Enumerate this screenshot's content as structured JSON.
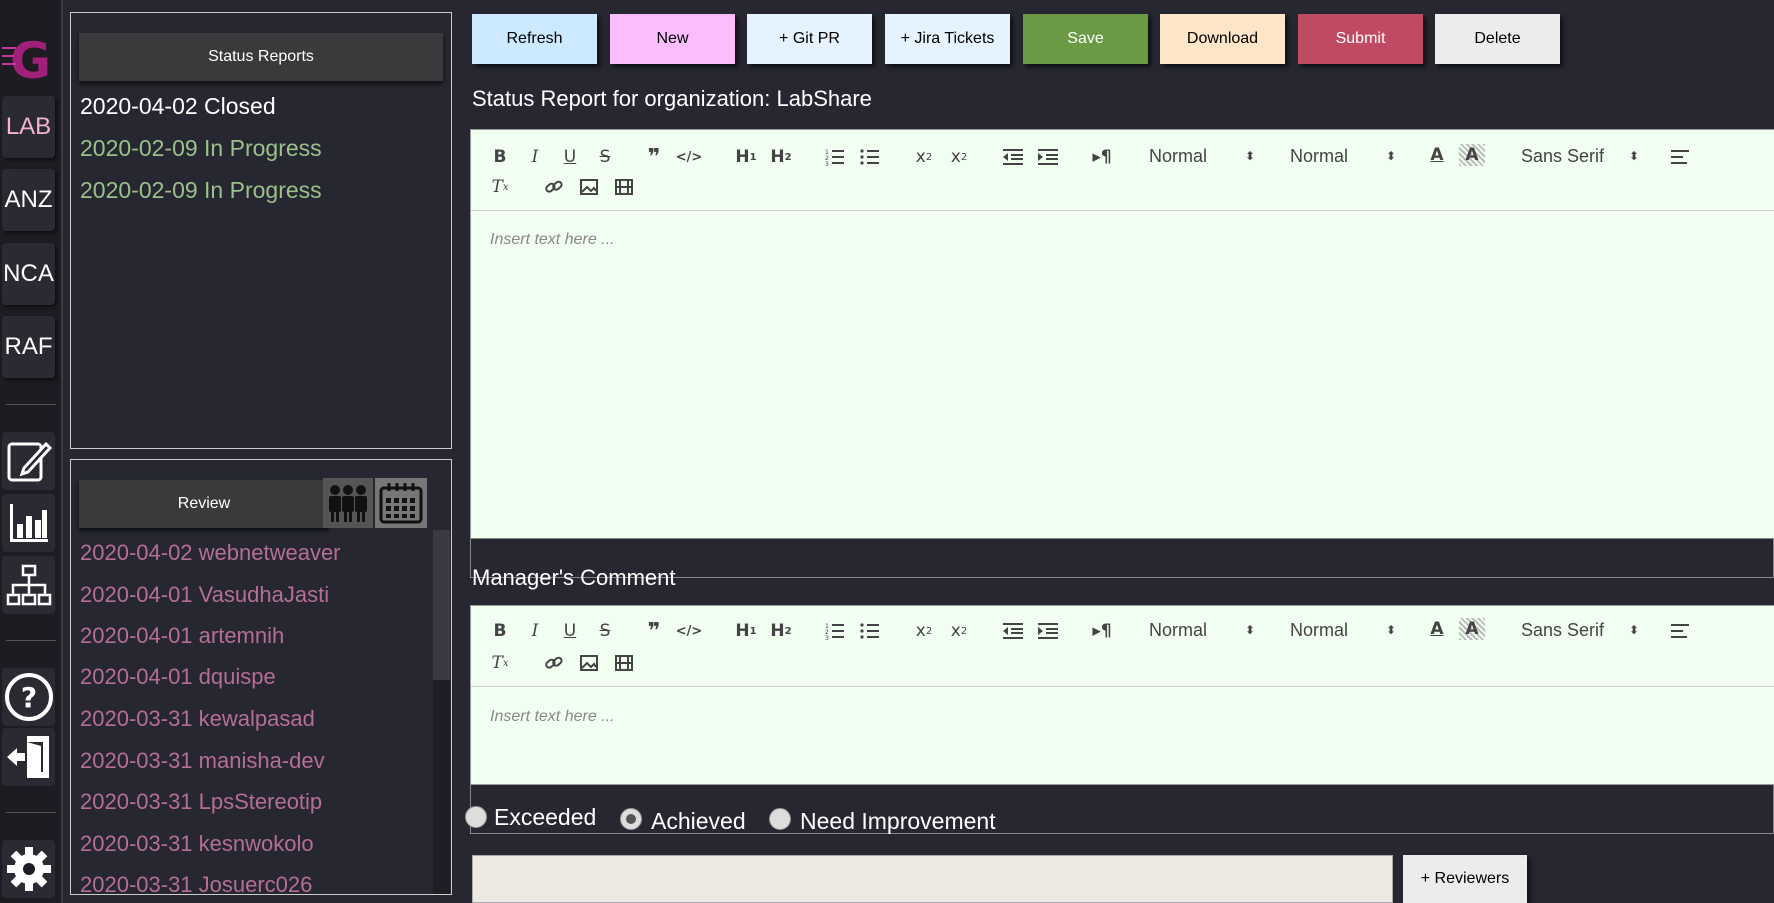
{
  "rail": {
    "orgs": [
      "LAB",
      "ANZ",
      "NCA",
      "RAF"
    ],
    "icons": [
      "edit-icon",
      "bar-chart-icon",
      "org-chart-icon",
      "help-icon",
      "logout-icon",
      "settings-icon"
    ],
    "active_org_color": "#f2b4cf"
  },
  "status_reports": {
    "title": "Status Reports",
    "items": [
      {
        "label": "2020-04-02 Closed",
        "color": "#ffffff"
      },
      {
        "label": "2020-02-09 In Progress",
        "color": "#9bc08a"
      },
      {
        "label": "2020-02-09 In Progress",
        "color": "#9bc08a"
      }
    ]
  },
  "review": {
    "title": "Review",
    "icons": [
      "team-icon",
      "calendar-icon"
    ],
    "items": [
      "2020-04-02 webnetweaver",
      "2020-04-01 VasudhaJasti",
      "2020-04-01 artemnih",
      "2020-04-01 dquispe",
      "2020-03-31 kewalpasad",
      "2020-03-31 manisha-dev",
      "2020-03-31 LpsStereotip",
      "2020-03-31 kesnwokolo",
      "2020-03-31 Josuerc026"
    ]
  },
  "toolbar": {
    "buttons": [
      {
        "label": "Refresh",
        "bg": "#cce9ff",
        "fg": "#000000"
      },
      {
        "label": "New",
        "bg": "#fbbdfd",
        "fg": "#000000"
      },
      {
        "label": "+ Git PR",
        "bg": "#e4f3ff",
        "fg": "#000000"
      },
      {
        "label": "+ Jira Tickets",
        "bg": "#e4f3ff",
        "fg": "#000000"
      },
      {
        "label": "Save",
        "bg": "#6a9a44",
        "fg": "#ffffff"
      },
      {
        "label": "Download",
        "bg": "#ffe5c8",
        "fg": "#000000"
      },
      {
        "label": "Submit",
        "bg": "#c04a62",
        "fg": "#ffffff"
      },
      {
        "label": "Delete",
        "bg": "#ececec",
        "fg": "#000000"
      }
    ]
  },
  "report": {
    "title": "Status Report for organization: LabShare",
    "placeholder": "Insert text here ..."
  },
  "manager": {
    "title": "Manager's Comment",
    "placeholder": "Insert text here ..."
  },
  "editor_toolbar": {
    "header_select": "Normal",
    "size_select": "Normal",
    "font_select": "Sans Serif"
  },
  "rating": {
    "options": [
      "Exceeded",
      "Achieved",
      "Need Improvement"
    ],
    "selected": "Achieved"
  },
  "reviewers_button": "+ Reviewers"
}
